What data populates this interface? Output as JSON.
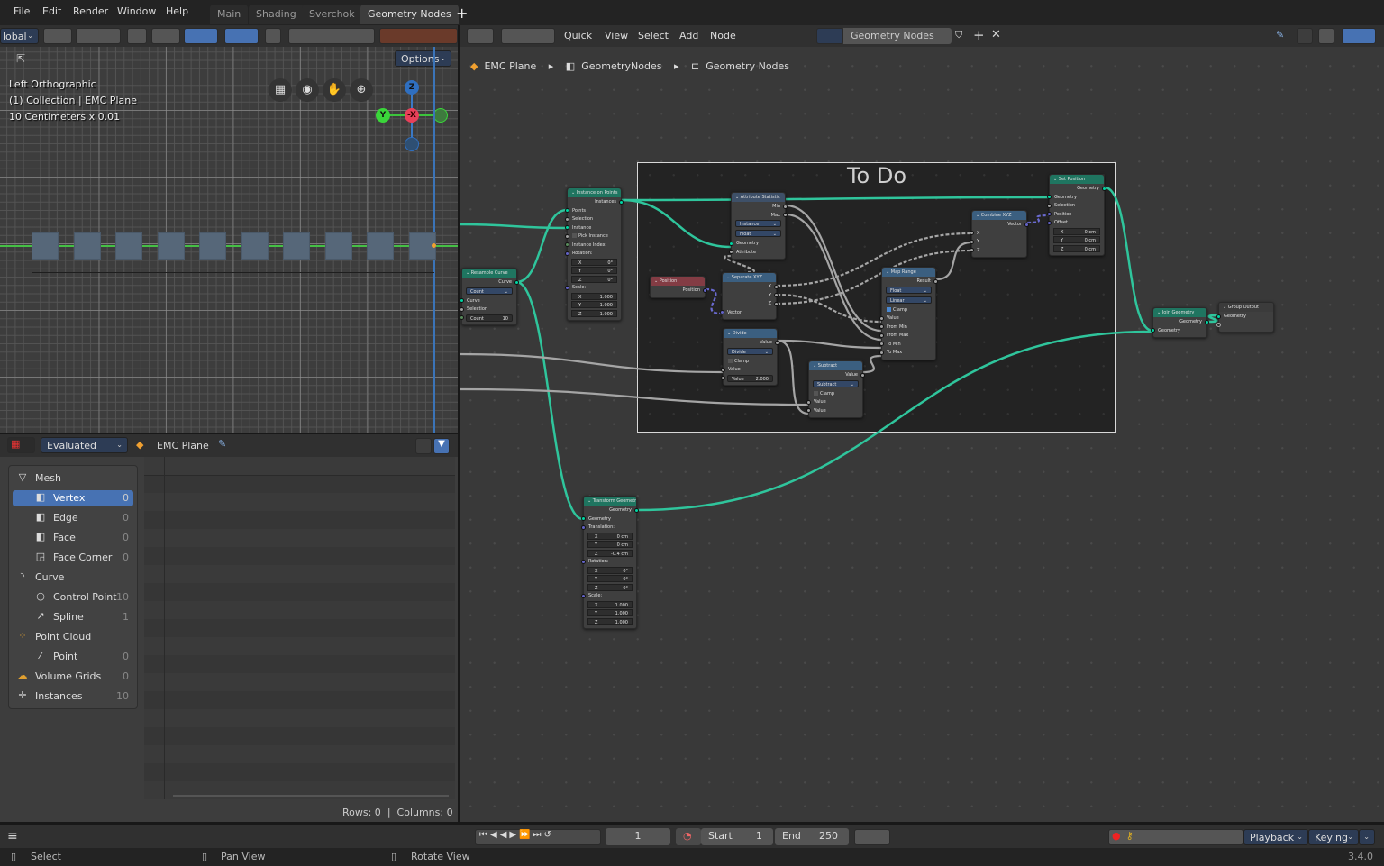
{
  "menu": [
    "File",
    "Edit",
    "Render",
    "Window",
    "Help"
  ],
  "workspaces": [
    {
      "label": "Main",
      "active": false
    },
    {
      "label": "Shading",
      "active": false
    },
    {
      "label": "Sverchok",
      "active": false
    },
    {
      "label": "Geometry Nodes",
      "active": true
    }
  ],
  "add_workspace": "+",
  "viewport": {
    "orientation": "lobal",
    "options_label": "Options",
    "overlay": [
      "Left Orthographic",
      "(1) Collection | EMC Plane",
      "10 Centimeters x 0.01"
    ],
    "gizmo": {
      "z": "Z",
      "y": "Y",
      "x": "-X"
    },
    "instance_count": 10,
    "nav_icons": [
      "grid-icon",
      "camera-icon",
      "hand-icon",
      "zoom-icon"
    ]
  },
  "spreadsheet": {
    "mode": "Evaluated",
    "object": "EMC Plane",
    "items": [
      {
        "label": "Mesh",
        "count": "",
        "indent": 0,
        "selected": false,
        "icon": "mesh-icon",
        "glyph": "▽"
      },
      {
        "label": "Vertex",
        "count": "0",
        "indent": 1,
        "selected": true,
        "icon": "vertex-icon",
        "glyph": "◧"
      },
      {
        "label": "Edge",
        "count": "0",
        "indent": 1,
        "selected": false,
        "icon": "edge-icon",
        "glyph": "◧"
      },
      {
        "label": "Face",
        "count": "0",
        "indent": 1,
        "selected": false,
        "icon": "face-icon",
        "glyph": "◧"
      },
      {
        "label": "Face Corner",
        "count": "0",
        "indent": 1,
        "selected": false,
        "icon": "face-corner-icon",
        "glyph": "◲"
      },
      {
        "label": "Curve",
        "count": "",
        "indent": 0,
        "selected": false,
        "icon": "curve-icon",
        "glyph": "◝"
      },
      {
        "label": "Control Point",
        "count": "10",
        "indent": 1,
        "selected": false,
        "icon": "control-point-icon",
        "glyph": "○"
      },
      {
        "label": "Spline",
        "count": "1",
        "indent": 1,
        "selected": false,
        "icon": "spline-icon",
        "glyph": "↗"
      },
      {
        "label": "Point Cloud",
        "count": "",
        "indent": 0,
        "selected": false,
        "icon": "point-cloud-icon",
        "glyph": "⁘"
      },
      {
        "label": "Point",
        "count": "0",
        "indent": 1,
        "selected": false,
        "icon": "point-icon",
        "glyph": "⁄"
      },
      {
        "label": "Volume Grids",
        "count": "0",
        "indent": 0,
        "selected": false,
        "icon": "volume-icon",
        "glyph": "☁"
      },
      {
        "label": "Instances",
        "count": "10",
        "indent": 0,
        "selected": false,
        "icon": "instances-icon",
        "glyph": "✛"
      }
    ],
    "rows_label": "Rows: 0",
    "separator": "|",
    "columns_label": "Columns: 0"
  },
  "node_editor": {
    "menu": [
      "Quick",
      "View",
      "Select",
      "Add",
      "Node"
    ],
    "tree_name": "Geometry Nodes",
    "breadcrumb": [
      "EMC Plane",
      "GeometryNodes",
      "Geometry Nodes"
    ],
    "frame_label": "To Do",
    "colors": {
      "geometry": "#1f7560",
      "converter": "#3b5f80",
      "attribute": "#3e5068",
      "input": "#833c44",
      "output": "#3b3b3b",
      "wire_geometry": "#2fc59c",
      "wire_float": "#a5a5a5",
      "wire_vector": "#6a6ad0"
    },
    "nodes": [
      {
        "id": "resample",
        "title": "Resample Curve",
        "kind": "geometry",
        "rows": [
          {
            "t": "out",
            "label": "Curve",
            "s": "g"
          },
          {
            "t": "select",
            "label": "Count"
          },
          {
            "t": "in",
            "label": "Curve",
            "s": "g"
          },
          {
            "t": "in",
            "label": "Selection",
            "s": "f"
          },
          {
            "t": "field",
            "label": "Count",
            "value": "10",
            "s": "i"
          }
        ]
      },
      {
        "id": "iop",
        "title": "Instance on Points",
        "kind": "geometry",
        "rows": [
          {
            "t": "out",
            "label": "Instances",
            "s": "g"
          },
          {
            "t": "in",
            "label": "Points",
            "s": "g"
          },
          {
            "t": "in",
            "label": "Selection",
            "s": "f"
          },
          {
            "t": "in",
            "label": "Instance",
            "s": "g"
          },
          {
            "t": "check",
            "label": "Pick Instance",
            "checked": false,
            "s": "f"
          },
          {
            "t": "in",
            "label": "Instance Index",
            "s": "i"
          },
          {
            "t": "in",
            "label": "Rotation:",
            "s": "v"
          },
          {
            "t": "vec",
            "label": "X",
            "value": "0°"
          },
          {
            "t": "vec",
            "label": "Y",
            "value": "0°"
          },
          {
            "t": "vec",
            "label": "Z",
            "value": "0°"
          },
          {
            "t": "in",
            "label": "Scale:",
            "s": "v"
          },
          {
            "t": "vec",
            "label": "X",
            "value": "1.000"
          },
          {
            "t": "vec",
            "label": "Y",
            "value": "1.000"
          },
          {
            "t": "vec",
            "label": "Z",
            "value": "1.000"
          }
        ]
      },
      {
        "id": "attrstat",
        "title": "Attribute Statistic",
        "kind": "attribute",
        "rows": [
          {
            "t": "out",
            "label": "Min",
            "s": "f"
          },
          {
            "t": "out",
            "label": "Max",
            "s": "f"
          },
          {
            "t": "select",
            "label": "Instance"
          },
          {
            "t": "select",
            "label": "Float"
          },
          {
            "t": "in",
            "label": "Geometry",
            "s": "g"
          },
          {
            "t": "in",
            "label": "Attribute",
            "s": "f"
          }
        ]
      },
      {
        "id": "position",
        "title": "Position",
        "kind": "input",
        "rows": [
          {
            "t": "out",
            "label": "Position",
            "s": "v"
          }
        ]
      },
      {
        "id": "separate",
        "title": "Separate XYZ",
        "kind": "converter",
        "rows": [
          {
            "t": "out",
            "label": "X",
            "s": "f"
          },
          {
            "t": "out",
            "label": "Y",
            "s": "f"
          },
          {
            "t": "out",
            "label": "Z",
            "s": "f"
          },
          {
            "t": "in",
            "label": "Vector",
            "s": "v"
          }
        ]
      },
      {
        "id": "divide",
        "title": "Divide",
        "kind": "converter",
        "rows": [
          {
            "t": "out",
            "label": "Value",
            "s": "f"
          },
          {
            "t": "select",
            "label": "Divide"
          },
          {
            "t": "check",
            "label": "Clamp",
            "checked": false
          },
          {
            "t": "in",
            "label": "Value",
            "s": "f"
          },
          {
            "t": "field",
            "label": "Value",
            "value": "2.000",
            "s": "f"
          }
        ]
      },
      {
        "id": "subtract",
        "title": "Subtract",
        "kind": "converter",
        "rows": [
          {
            "t": "out",
            "label": "Value",
            "s": "f"
          },
          {
            "t": "select",
            "label": "Subtract"
          },
          {
            "t": "check",
            "label": "Clamp",
            "checked": false
          },
          {
            "t": "in",
            "label": "Value",
            "s": "f"
          },
          {
            "t": "in",
            "label": "Value",
            "s": "f"
          }
        ]
      },
      {
        "id": "maprange",
        "title": "Map Range",
        "kind": "converter",
        "rows": [
          {
            "t": "out",
            "label": "Result",
            "s": "f"
          },
          {
            "t": "select",
            "label": "Float"
          },
          {
            "t": "select",
            "label": "Linear"
          },
          {
            "t": "check",
            "label": "Clamp",
            "checked": true
          },
          {
            "t": "in",
            "label": "Value",
            "s": "f"
          },
          {
            "t": "in",
            "label": "From Min",
            "s": "f"
          },
          {
            "t": "in",
            "label": "From Max",
            "s": "f"
          },
          {
            "t": "in",
            "label": "To Min",
            "s": "f"
          },
          {
            "t": "in",
            "label": "To Max",
            "s": "f"
          }
        ]
      },
      {
        "id": "combine",
        "title": "Combine XYZ",
        "kind": "converter",
        "rows": [
          {
            "t": "out",
            "label": "Vector",
            "s": "v"
          },
          {
            "t": "in",
            "label": "X",
            "s": "f"
          },
          {
            "t": "in",
            "label": "Y",
            "s": "f"
          },
          {
            "t": "in",
            "label": "Z",
            "s": "f"
          }
        ]
      },
      {
        "id": "setpos",
        "title": "Set Position",
        "kind": "geometry",
        "rows": [
          {
            "t": "out",
            "label": "Geometry",
            "s": "g"
          },
          {
            "t": "in",
            "label": "Geometry",
            "s": "g"
          },
          {
            "t": "in",
            "label": "Selection",
            "s": "f"
          },
          {
            "t": "in",
            "label": "Position",
            "s": "v"
          },
          {
            "t": "in",
            "label": "Offset",
            "s": "v"
          },
          {
            "t": "vec",
            "label": "X",
            "value": "0 cm"
          },
          {
            "t": "vec",
            "label": "Y",
            "value": "0 cm"
          },
          {
            "t": "vec",
            "label": "Z",
            "value": "0 cm"
          }
        ]
      },
      {
        "id": "join",
        "title": "Join Geometry",
        "kind": "geometry",
        "rows": [
          {
            "t": "out",
            "label": "Geometry",
            "s": "g"
          },
          {
            "t": "in",
            "label": "Geometry",
            "s": "g"
          }
        ]
      },
      {
        "id": "groupout",
        "title": "Group Output",
        "kind": "output",
        "rows": [
          {
            "t": "in",
            "label": "Geometry",
            "s": "g"
          },
          {
            "t": "in",
            "label": "",
            "s": "e"
          }
        ]
      },
      {
        "id": "transform",
        "title": "Transform Geometry",
        "kind": "geometry",
        "rows": [
          {
            "t": "out",
            "label": "Geometry",
            "s": "g"
          },
          {
            "t": "in",
            "label": "Geometry",
            "s": "g"
          },
          {
            "t": "in",
            "label": "Translation:",
            "s": "v"
          },
          {
            "t": "vec",
            "label": "X",
            "value": "0 cm"
          },
          {
            "t": "vec",
            "label": "Y",
            "value": "0 cm"
          },
          {
            "t": "vec",
            "label": "Z",
            "value": "-0.4 cm"
          },
          {
            "t": "in",
            "label": "Rotation:",
            "s": "v"
          },
          {
            "t": "vec",
            "label": "X",
            "value": "0°"
          },
          {
            "t": "vec",
            "label": "Y",
            "value": "0°"
          },
          {
            "t": "vec",
            "label": "Z",
            "value": "0°"
          },
          {
            "t": "in",
            "label": "Scale:",
            "s": "v"
          },
          {
            "t": "vec",
            "label": "X",
            "value": "1.000"
          },
          {
            "t": "vec",
            "label": "Y",
            "value": "1.000"
          },
          {
            "t": "vec",
            "label": "Z",
            "value": "1.000"
          }
        ]
      }
    ]
  },
  "timeline": {
    "frame": "1",
    "start_label": "Start",
    "start": "1",
    "end_label": "End",
    "end": "250",
    "playback": "Playback",
    "keying": "Keying"
  },
  "status": {
    "items": [
      "Select",
      "Pan View",
      "Rotate View"
    ],
    "version": "3.4.0"
  }
}
